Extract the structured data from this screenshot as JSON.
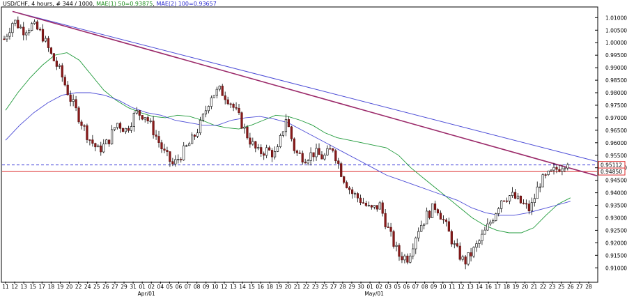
{
  "header": {
    "symbol": "USD/CHF",
    "timeframe": "4 hours",
    "bars": "# 344 / 1000",
    "ma1": "MAE(1) 50=0.93875",
    "ma2": "MAE(2) 100=0.93657"
  },
  "chart_data": {
    "type": "candlestick",
    "price_axis": {
      "range": [
        0.9045,
        1.014
      ],
      "labels": [
        "1.01000",
        "1.00500",
        "1.00000",
        "0.99500",
        "0.99000",
        "0.98500",
        "0.98000",
        "0.97500",
        "0.97000",
        "0.96500",
        "0.96000",
        "0.95500",
        "0.95000",
        "0.94500",
        "0.94000",
        "0.93500",
        "0.93000",
        "0.92500",
        "0.92000",
        "0.91500",
        "0.91000"
      ]
    },
    "date_axis": {
      "labels": [
        "11",
        "12",
        "13",
        "15",
        "17",
        "18",
        "19",
        "20",
        "22",
        "24",
        "25",
        "26",
        "27",
        "29",
        "31",
        "01",
        "02",
        "04",
        "05",
        "06",
        "07",
        "08",
        "09",
        "10",
        "12",
        "13",
        "14",
        "15",
        "16",
        "18",
        "19",
        "20",
        "21",
        "22",
        "23",
        "25",
        "27",
        "28",
        "29",
        "30",
        "01",
        "02",
        "03",
        "05",
        "06",
        "07",
        "08",
        "09",
        "10",
        "11",
        "12",
        "13",
        "14",
        "16",
        "17",
        "18",
        "19",
        "20",
        "21",
        "22",
        "23",
        "25",
        "26",
        "27",
        "28"
      ],
      "months": [
        {
          "label": "Apr/01",
          "after_index": 15
        },
        {
          "label": "May/01",
          "after_index": 40
        }
      ]
    },
    "price_tags": [
      {
        "label": "0.95112",
        "value": 0.95112,
        "color": "#dc2a2a"
      },
      {
        "label": "0.94850",
        "value": 0.9485,
        "color": "#dc2a2a"
      }
    ],
    "horizontal_lines": [
      {
        "value": 0.95112,
        "style": "dashed",
        "color": "#3a3ad8"
      },
      {
        "value": 0.9485,
        "style": "solid",
        "color": "#dc2a2a"
      }
    ],
    "trendlines": [
      {
        "from": [
          0,
          1.0125
        ],
        "to": [
          64,
          0.9525
        ],
        "color": "#4b4bd6"
      },
      {
        "from": [
          0,
          1.0125
        ],
        "to": [
          64,
          0.9468
        ],
        "color": "#9b2a6a"
      }
    ],
    "moving_averages": [
      {
        "period": 50,
        "color": "#1f9a3a",
        "values": [
          0.973,
          0.98,
          0.986,
          0.991,
          0.995,
          0.996,
          0.993,
          0.987,
          0.981,
          0.977,
          0.974,
          0.972,
          0.9705,
          0.97,
          0.971,
          0.9705,
          0.969,
          0.967,
          0.966,
          0.9655,
          0.967,
          0.969,
          0.971,
          0.9705,
          0.969,
          0.967,
          0.964,
          0.962,
          0.961,
          0.96,
          0.959,
          0.958,
          0.955,
          0.95,
          0.946,
          0.942,
          0.938,
          0.934,
          0.93,
          0.927,
          0.925,
          0.924,
          0.924,
          0.926,
          0.931,
          0.9355,
          0.938
        ]
      },
      {
        "period": 100,
        "color": "#4b4bd6",
        "values": [
          0.961,
          0.967,
          0.972,
          0.976,
          0.979,
          0.98,
          0.98,
          0.979,
          0.977,
          0.974,
          0.972,
          0.971,
          0.969,
          0.968,
          0.967,
          0.967,
          0.969,
          0.97,
          0.9705,
          0.9695,
          0.968,
          0.965,
          0.962,
          0.959,
          0.956,
          0.953,
          0.95,
          0.947,
          0.945,
          0.943,
          0.941,
          0.939,
          0.937,
          0.934,
          0.932,
          0.931,
          0.931,
          0.932,
          0.9335,
          0.935,
          0.9366
        ]
      }
    ],
    "candles": [
      1.0015,
      1.009,
      1.005,
      1.007,
      1.0035,
      0.995,
      0.988,
      0.978,
      0.97,
      0.962,
      0.957,
      0.96,
      0.968,
      0.965,
      0.972,
      0.971,
      0.964,
      0.956,
      0.951,
      0.956,
      0.961,
      0.968,
      0.979,
      0.981,
      0.977,
      0.97,
      0.962,
      0.956,
      0.957,
      0.955,
      0.97,
      0.956,
      0.954,
      0.956,
      0.954,
      0.958,
      0.947,
      0.94,
      0.937,
      0.933,
      0.935,
      0.924,
      0.915,
      0.914,
      0.925,
      0.931,
      0.935,
      0.927,
      0.918,
      0.912,
      0.917,
      0.923,
      0.93,
      0.938,
      0.939,
      0.936,
      0.933,
      0.944,
      0.947,
      0.95,
      0.953
    ]
  }
}
